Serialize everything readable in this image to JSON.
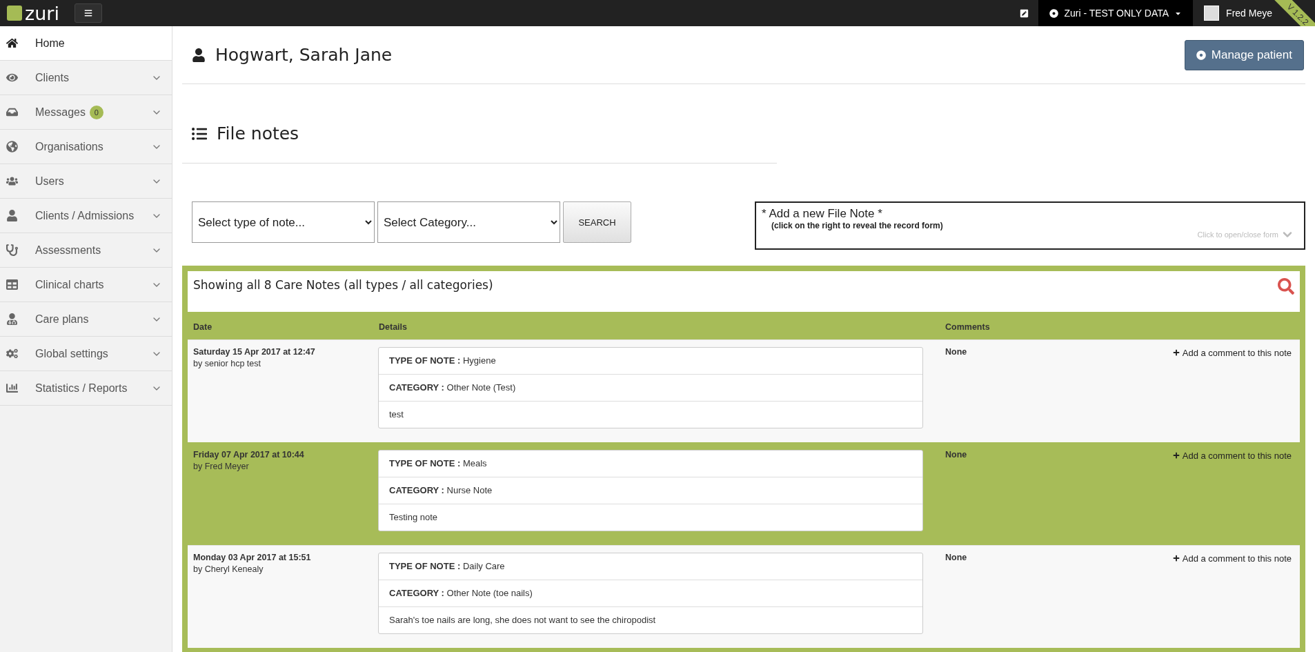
{
  "topbar": {
    "logo": "zuri",
    "environment": "Zuri - TEST ONLY DATA",
    "user": "Fred Meye",
    "version": "V 1.2.2"
  },
  "sidebar": {
    "items": [
      {
        "label": "Home",
        "selected": true,
        "has_submenu": false
      },
      {
        "label": "Clients",
        "selected": false,
        "has_submenu": true
      },
      {
        "label": "Messages",
        "badge": "0",
        "selected": false,
        "has_submenu": true
      },
      {
        "label": "Organisations",
        "selected": false,
        "has_submenu": true
      },
      {
        "label": "Users",
        "selected": false,
        "has_submenu": true
      },
      {
        "label": "Clients / Admissions",
        "selected": false,
        "has_submenu": true
      },
      {
        "label": "Assessments",
        "selected": false,
        "has_submenu": true
      },
      {
        "label": "Clinical charts",
        "selected": false,
        "has_submenu": true
      },
      {
        "label": "Care plans",
        "selected": false,
        "has_submenu": true
      },
      {
        "label": "Global settings",
        "selected": false,
        "has_submenu": true
      },
      {
        "label": "Statistics / Reports",
        "selected": false,
        "has_submenu": true
      }
    ]
  },
  "patient": {
    "name": "Hogwart, Sarah Jane",
    "action": "Manage patient"
  },
  "section_title": "File notes",
  "filters": {
    "type": {
      "value": "Select type of note..."
    },
    "category": {
      "value": "Select Category..."
    },
    "search_button": "SEARCH"
  },
  "add_note": {
    "title": "* Add a new File Note *",
    "hint": "(click on the right to reveal the record form)",
    "toggle": "Click to open/close form",
    "expanded": false
  },
  "notes_table": {
    "summary": "Showing all 8 Care Notes (all types / all categories)",
    "columns": [
      "Date",
      "Details",
      "Comments"
    ],
    "rows": [
      {
        "date": "Saturday 15 Apr 2017 at 12:47",
        "author": "by senior hcp test",
        "type_line": "**TYPE OF NOTE :** Hygiene",
        "category_line": "**CATEGORY :** Other Note (Test)",
        "text": "test",
        "comments": "None",
        "add_comment": "Add a comment to this note"
      },
      {
        "date": "Friday 07 Apr 2017 at 10:44",
        "author": "by Fred Meyer",
        "type_line": "**TYPE OF NOTE :** Meals",
        "category_line": "**CATEGORY :** Nurse Note",
        "text": "Testing note",
        "comments": "None",
        "add_comment": "Add a comment to this note"
      },
      {
        "date": "Monday 03 Apr 2017 at 15:51",
        "author": "by Cheryl Kenealy",
        "type_line": "**TYPE OF NOTE :** Daily Care",
        "category_line": "**CATEGORY :** Other Note (toe nails)",
        "text": "Sarah's toe nails are long, she does not want to see the chiropodist",
        "comments": "None",
        "add_comment": "Add a comment to this note"
      }
    ]
  }
}
